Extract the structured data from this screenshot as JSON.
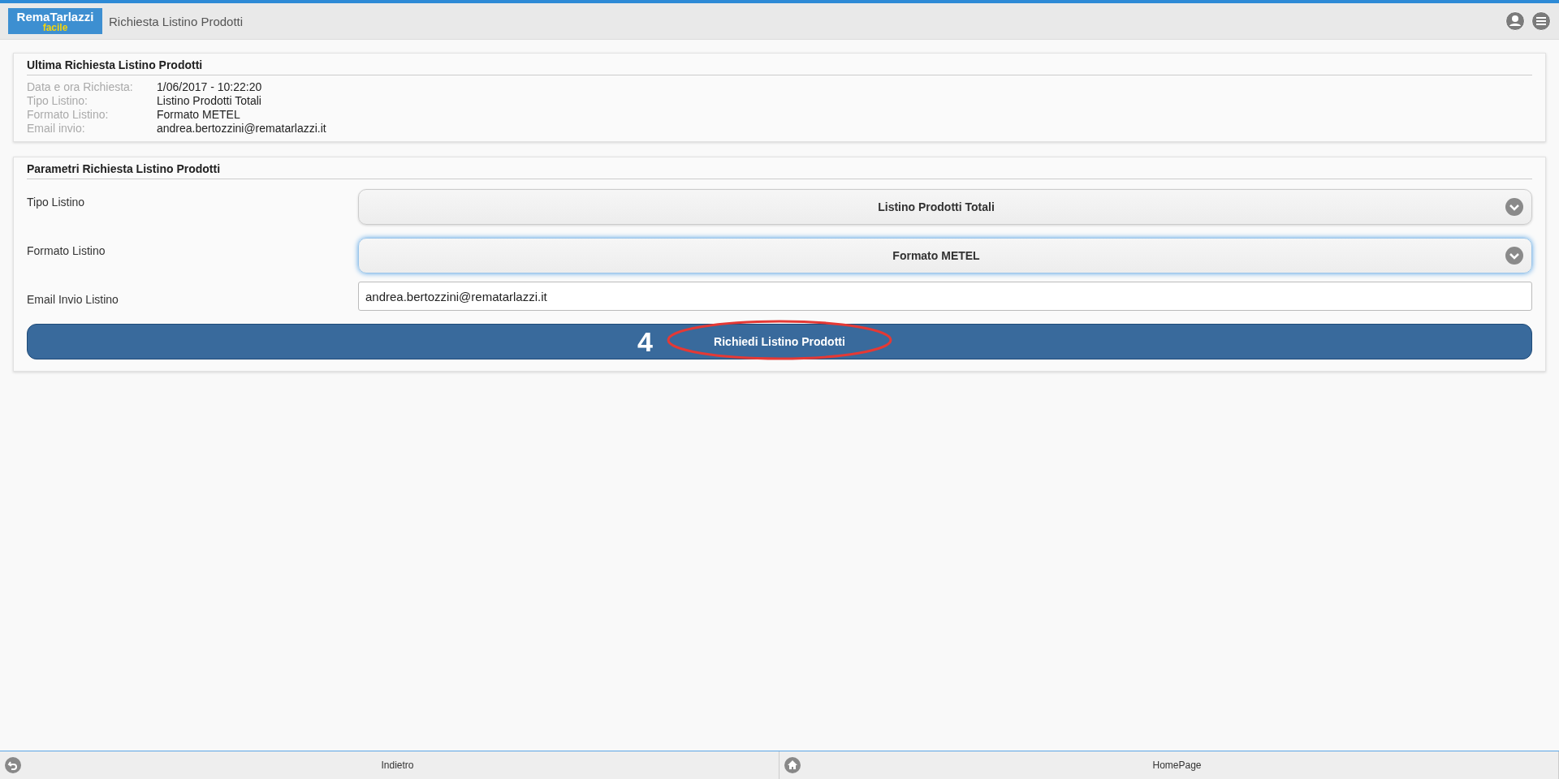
{
  "header": {
    "logo": {
      "brand": "RemaTarlazzi",
      "tagline": "facile"
    },
    "title": "Richiesta Listino Prodotti"
  },
  "last_request": {
    "title": "Ultima Richiesta Listino Prodotti",
    "rows": [
      {
        "label": "Data e ora Richiesta:",
        "value": "1/06/2017 - 10:22:20"
      },
      {
        "label": "Tipo Listino:",
        "value": "Listino Prodotti Totali"
      },
      {
        "label": "Formato Listino:",
        "value": "Formato METEL"
      },
      {
        "label": "Email invio:",
        "value": "andrea.bertozzini@rematarlazzi.it"
      }
    ]
  },
  "form": {
    "title": "Parametri Richiesta Listino Prodotti",
    "fields": [
      {
        "kind": "select",
        "label": "Tipo Listino",
        "value": "Listino Prodotti Totali",
        "focused": false
      },
      {
        "kind": "select",
        "label": "Formato Listino",
        "value": "Formato METEL",
        "focused": true
      },
      {
        "kind": "input",
        "label": "Email Invio Listino",
        "value": "andrea.bertozzini@rematarlazzi.it",
        "focused": false
      }
    ],
    "submit": {
      "label": "Richiedi Listino Prodotti",
      "step": "4"
    }
  },
  "footer": [
    {
      "kind": "back",
      "label": "Indietro"
    },
    {
      "kind": "home",
      "label": "HomePage"
    }
  ]
}
